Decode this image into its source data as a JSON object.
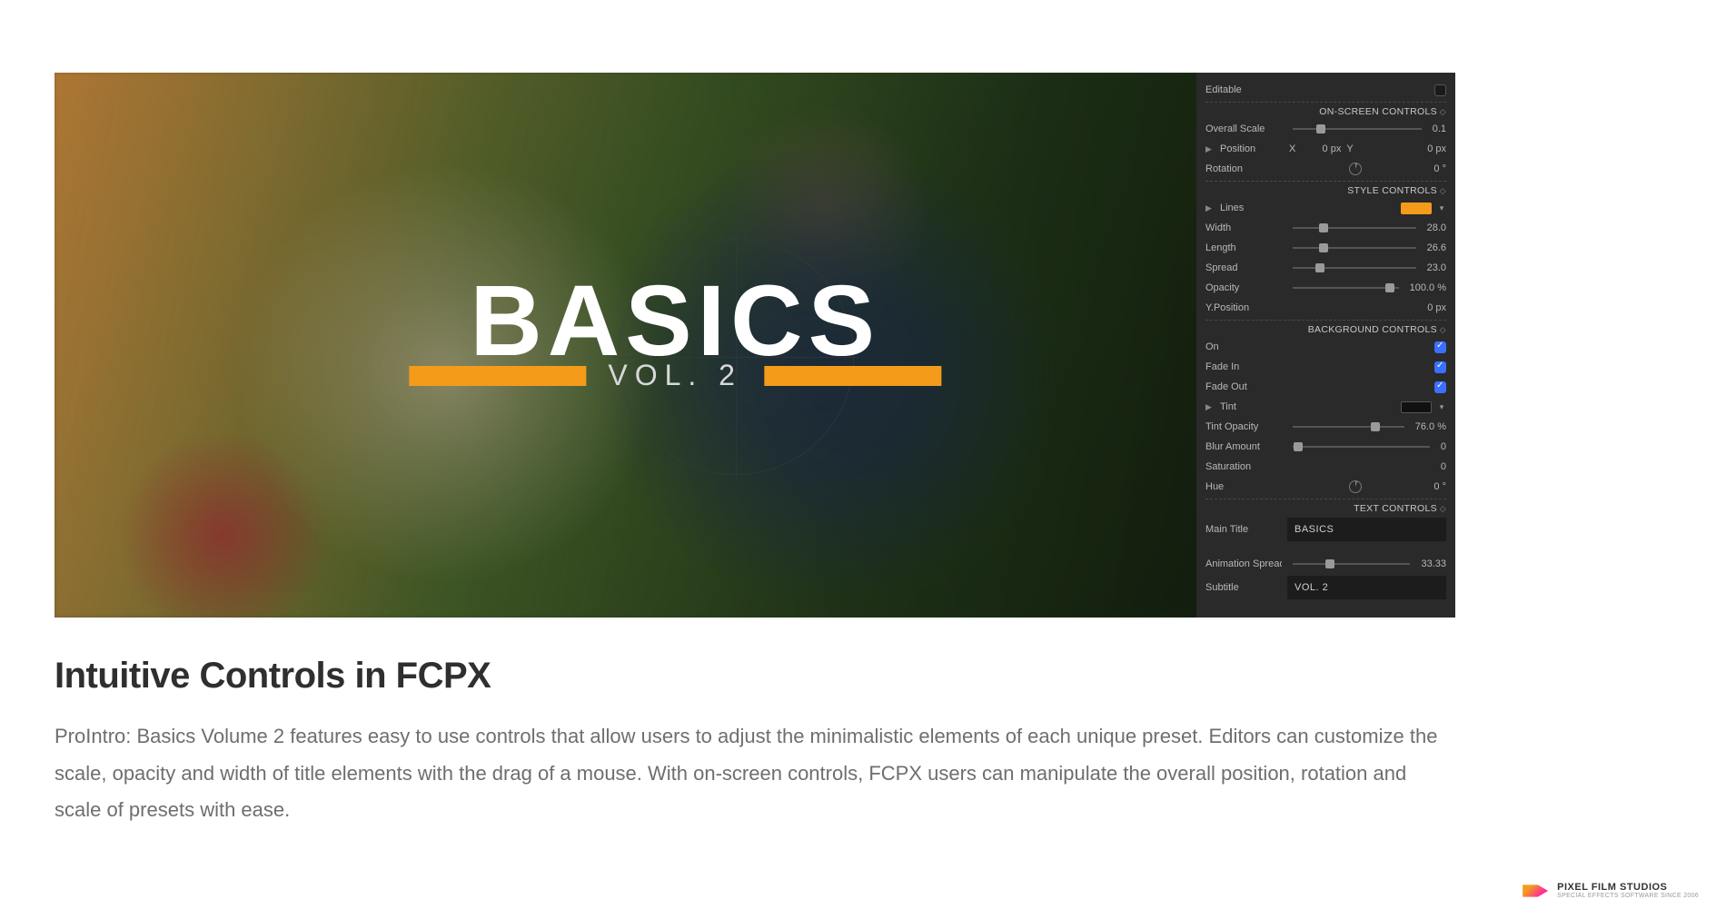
{
  "overlay": {
    "main_title": "BASICS",
    "subtitle": "VOL. 2"
  },
  "panel": {
    "editable_label": "Editable",
    "sections": {
      "onscreen": "ON-SCREEN CONTROLS",
      "style": "STYLE CONTROLS",
      "background": "BACKGROUND CONTROLS",
      "text": "TEXT CONTROLS"
    },
    "overall_scale": {
      "label": "Overall Scale",
      "value": "0.1",
      "pos": 22
    },
    "position": {
      "label": "Position",
      "x_label": "X",
      "x_val": "0 px",
      "y_label": "Y",
      "y_val": "0 px"
    },
    "rotation": {
      "label": "Rotation",
      "value": "0 °"
    },
    "lines_label": "Lines",
    "width": {
      "label": "Width",
      "value": "28.0",
      "pos": 25
    },
    "length": {
      "label": "Length",
      "value": "26.6",
      "pos": 25
    },
    "spread": {
      "label": "Spread",
      "value": "23.0",
      "pos": 22
    },
    "opacity": {
      "label": "Opacity",
      "value": "100.0 %",
      "pos": 92
    },
    "yposition": {
      "label": "Y.Position",
      "value": "0 px"
    },
    "on": {
      "label": "On",
      "checked": true
    },
    "fadein": {
      "label": "Fade In",
      "checked": true
    },
    "fadeout": {
      "label": "Fade Out",
      "checked": true
    },
    "tint_label": "Tint",
    "tint_opacity": {
      "label": "Tint Opacity",
      "value": "76.0 %",
      "pos": 74
    },
    "blur": {
      "label": "Blur Amount",
      "value": "0",
      "pos": 4
    },
    "saturation": {
      "label": "Saturation",
      "value": "0"
    },
    "hue": {
      "label": "Hue",
      "value": "0 °"
    },
    "main_title": {
      "label": "Main Title",
      "value": "BASICS"
    },
    "anim_spread": {
      "label": "Animation Spread",
      "value": "33.33",
      "pos": 32
    },
    "subtitle": {
      "label": "Subtitle",
      "value": "VOL. 2"
    }
  },
  "article": {
    "heading": "Intuitive Controls in FCPX",
    "body": "ProIntro: Basics Volume 2 features easy to use controls that allow users to adjust the minimalistic elements of each unique preset. Editors can customize the scale, opacity and width of title elements with the drag of a mouse. With on-screen controls, FCPX users can manipulate the overall position, rotation and scale of presets with ease."
  },
  "brand": {
    "name": "PIXEL FILM STUDIOS",
    "tag": "SPECIAL EFFECTS SOFTWARE SINCE 2006"
  }
}
